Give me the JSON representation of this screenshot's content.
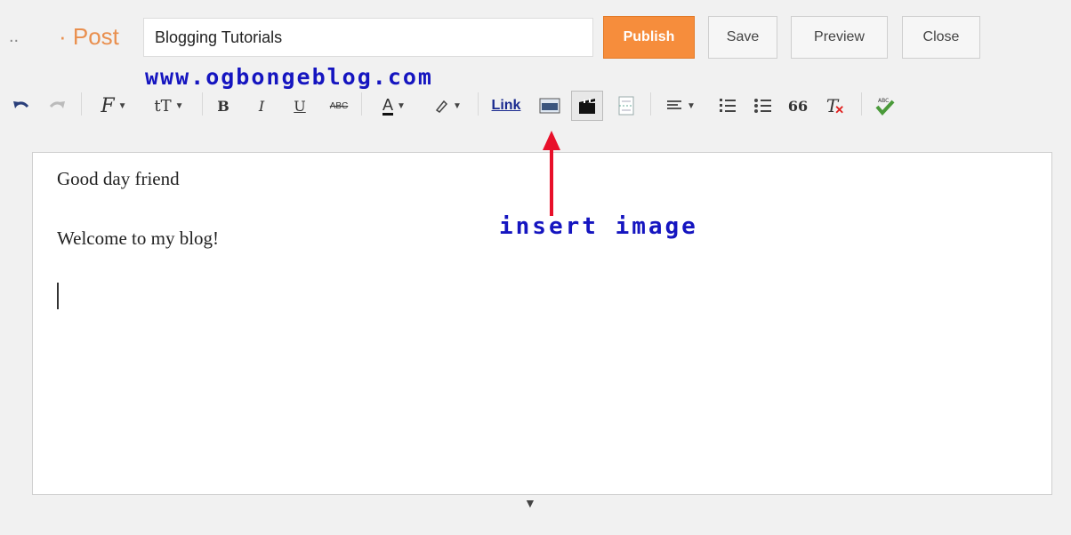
{
  "header": {
    "breadcrumb_dots": "..",
    "breadcrumb_label": "· Post",
    "title_value": "Blogging Tutorials",
    "publish_label": "Publish",
    "save_label": "Save",
    "preview_label": "Preview",
    "close_label": "Close"
  },
  "watermark": "www.ogbongeblog.com",
  "toolbar": {
    "link_label": "Link",
    "icons": [
      "undo-icon",
      "redo-icon",
      "font-family-icon",
      "font-size-icon",
      "bold-icon",
      "italic-icon",
      "underline-icon",
      "strikethrough-icon",
      "text-color-icon",
      "highlight-icon",
      "insert-image-icon",
      "insert-video-icon",
      "insert-jump-break-icon",
      "align-icon",
      "numbered-list-icon",
      "bulleted-list-icon",
      "quote-icon",
      "remove-formatting-icon",
      "spellcheck-icon"
    ],
    "bold_glyph": "B",
    "italic_glyph": "I",
    "underline_glyph": "U",
    "strike_glyph": "ABC",
    "textcolor_glyph": "A",
    "quote_glyph": "66",
    "clearformat_glyph": "T",
    "font_glyph": "F",
    "size_glyph": "tT"
  },
  "editor": {
    "line1": "Good day friend",
    "line2": "Welcome to my blog!"
  },
  "annotation": "insert image",
  "colors": {
    "accent": "#f68d3c",
    "annotation_blue": "#1515c0",
    "arrow_red": "#e8102a"
  }
}
